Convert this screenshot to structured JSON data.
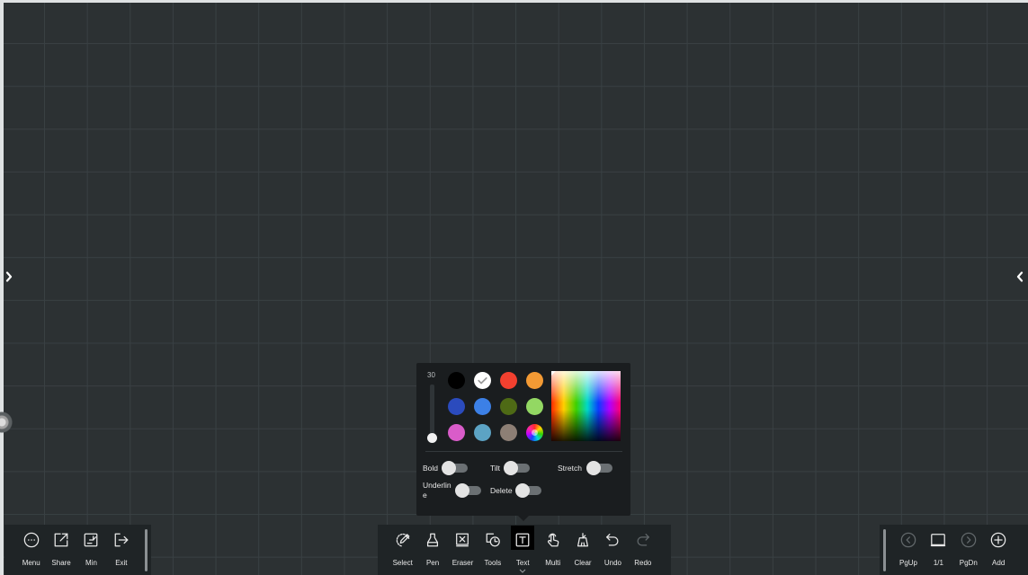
{
  "colors": {
    "canvas_bg": "#2c3133",
    "grid_line": "#394043",
    "toolbar_bg": "#1f2426",
    "panel_bg": "#1a1d1f",
    "icon": "#e8e8e8",
    "icon_disabled": "#62686b",
    "active_bg": "#000000",
    "label_text": "#e8e8e8"
  },
  "edge_tabs": {
    "left_icon": "chevron-right-icon",
    "right_icon": "chevron-left-icon",
    "handle_icon": "floating-handle-icon"
  },
  "left_toolbar": {
    "items": [
      {
        "label": "Menu",
        "icon": "menu-icon"
      },
      {
        "label": "Share",
        "icon": "share-icon"
      },
      {
        "label": "Min",
        "icon": "minimize-icon"
      },
      {
        "label": "Exit",
        "icon": "exit-icon"
      }
    ]
  },
  "center_toolbar": {
    "items": [
      {
        "label": "Select",
        "icon": "select-icon"
      },
      {
        "label": "Pen",
        "icon": "pen-icon"
      },
      {
        "label": "Eraser",
        "icon": "eraser-icon"
      },
      {
        "label": "Tools",
        "icon": "shapes-icon"
      },
      {
        "label": "Text",
        "icon": "text-icon",
        "active": true
      },
      {
        "label": "Multi",
        "icon": "multi-touch-icon"
      },
      {
        "label": "Clear",
        "icon": "clear-icon"
      },
      {
        "label": "Undo",
        "icon": "undo-icon"
      },
      {
        "label": "Redo",
        "icon": "redo-icon",
        "disabled": true
      }
    ]
  },
  "right_toolbar": {
    "items": [
      {
        "label": "PgUp",
        "icon": "page-up-icon",
        "disabled": true
      },
      {
        "label": "1/1",
        "icon": "page-icon"
      },
      {
        "label": "PgDn",
        "icon": "page-down-icon",
        "disabled": true
      },
      {
        "label": "Add",
        "icon": "add-page-icon"
      }
    ]
  },
  "text_settings_panel": {
    "font_size": "30",
    "size_slider_level": 0,
    "swatches": [
      {
        "color": "#000000"
      },
      {
        "color": "#ffffff",
        "selected": true
      },
      {
        "color": "#f2402f"
      },
      {
        "color": "#f39a34"
      },
      {
        "color": "#2b4bbd"
      },
      {
        "color": "#3c80e6"
      },
      {
        "color": "#4e6a15"
      },
      {
        "color": "#93d863"
      },
      {
        "color": "#d95cc9"
      },
      {
        "color": "#5ca3c4"
      },
      {
        "color": "#8d7f75"
      },
      {
        "icon": "color-wheel-icon"
      }
    ],
    "toggles": [
      {
        "label": "Bold",
        "on": false
      },
      {
        "label": "Tilt",
        "on": false
      },
      {
        "label": "Stretch",
        "on": false
      },
      {
        "label": "Underline",
        "on": false
      },
      {
        "label": "Delete",
        "on": false
      }
    ]
  }
}
